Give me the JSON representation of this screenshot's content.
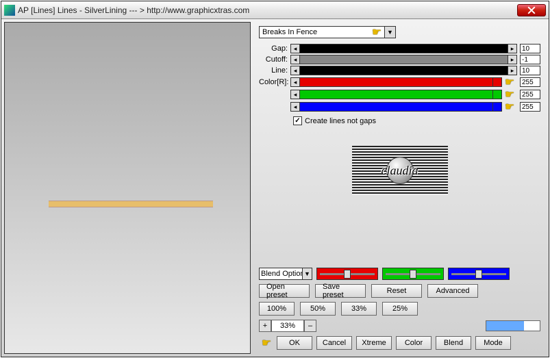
{
  "window": {
    "title": "AP [Lines]  Lines - SilverLining    --- >  http://www.graphicxtras.com"
  },
  "preset": {
    "selected": "Breaks In Fence"
  },
  "sliders": {
    "gap": {
      "label": "Gap:",
      "value": "10"
    },
    "cutoff": {
      "label": "Cutoff:",
      "value": "-1"
    },
    "line": {
      "label": "Line:",
      "value": "10"
    },
    "colorR": {
      "label": "Color[R]:",
      "value": "255"
    },
    "colorG": {
      "value": "255"
    },
    "colorB": {
      "value": "255"
    }
  },
  "checkbox": {
    "create_lines": {
      "label": "Create lines not gaps",
      "checked": true
    }
  },
  "logo": {
    "text": "claudia"
  },
  "blend": {
    "mode_label": "Blend Options"
  },
  "buttons": {
    "open_preset": "Open preset",
    "save_preset": "Save preset",
    "reset": "Reset",
    "advanced": "Advanced",
    "p100": "100%",
    "p50": "50%",
    "p33": "33%",
    "p25": "25%",
    "plus": "+",
    "minus": "–",
    "zoom_val": "33%",
    "ok": "OK",
    "cancel": "Cancel",
    "xtreme": "Xtreme",
    "color": "Color",
    "blend": "Blend",
    "mode": "Mode"
  },
  "colors": {
    "red": "#e60000",
    "green": "#00c800",
    "blue": "#0000ff",
    "progress": "#66aaff"
  }
}
